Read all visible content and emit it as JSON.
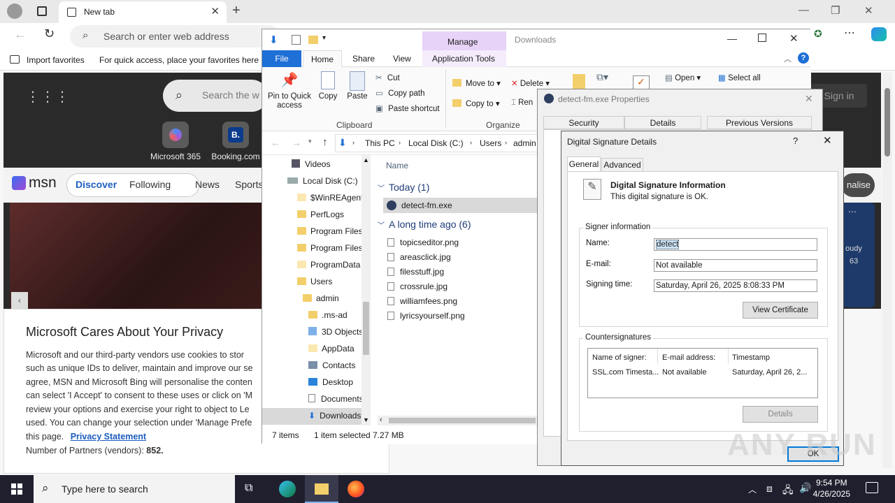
{
  "browser": {
    "tab_title": "New tab",
    "address_placeholder": "Search or enter web address",
    "favbar": {
      "import": "Import favorites",
      "hint": "For quick access, place your favorites here on"
    },
    "msn": {
      "search_placeholder": "Search the w",
      "shortcuts": [
        "Microsoft 365",
        "Booking.com"
      ],
      "sign_in": "Sign in",
      "brand": "msn",
      "nav": [
        "Discover",
        "Following",
        "News",
        "Sports"
      ],
      "personalise": "nalise",
      "weather_fragment": "oudy",
      "temp_fragment": "63"
    },
    "privacy": {
      "title": "Microsoft Cares About Your Privacy",
      "lines": [
        "Microsoft and our third-party vendors use cookies to stor",
        "such as unique IDs to deliver, maintain and improve our se",
        "agree, MSN and Microsoft Bing will personalise the conten",
        "can select 'I Accept' to consent to these uses or click on 'M",
        "review your options and exercise your right to object to Le",
        "used. You can change your selection under 'Manage Prefe"
      ],
      "page_prefix": "this page.",
      "link": "Privacy Statement",
      "partners_label": "Number of Partners (vendors):",
      "partners_count": "852."
    }
  },
  "explorer": {
    "title": "Downloads",
    "manage": "Manage",
    "tabs": [
      "File",
      "Home",
      "Share",
      "View",
      "Application Tools"
    ],
    "ribbon": {
      "pin": "Pin to Quick access",
      "copy": "Copy",
      "paste": "Paste",
      "cut": "Cut",
      "copy_path": "Copy path",
      "paste_shortcut": "Paste shortcut",
      "move_to": "Move to",
      "copy_to": "Copy to",
      "delete": "Delete",
      "rename": "Ren",
      "open": "Open",
      "select_all": "Select all",
      "group_clipboard": "Clipboard",
      "group_organize": "Organize"
    },
    "breadcrumb": [
      "This PC",
      "Local Disk (C:)",
      "Users",
      "admin"
    ],
    "tree": [
      "Videos",
      "Local Disk (C:)",
      "$WinREAgent",
      "PerfLogs",
      "Program Files",
      "Program Files",
      "ProgramData",
      "Users",
      "admin",
      ".ms-ad",
      "3D Objects",
      "AppData",
      "Contacts",
      "Desktop",
      "Documents",
      "Downloads"
    ],
    "column_name": "Name",
    "group_today": "Today (1)",
    "group_old": "A long time ago (6)",
    "selected_file": "detect-fm.exe",
    "files": [
      "topicseditor.png",
      "areasclick.jpg",
      "filesstuff.jpg",
      "crossrule.jpg",
      "williamfees.png",
      "lyricsyourself.png"
    ],
    "status": {
      "items": "7 items",
      "selected": "1 item selected",
      "size": "7.27 MB"
    }
  },
  "properties": {
    "title": "detect-fm.exe Properties",
    "tabs": [
      "Security",
      "Details",
      "Previous Versions"
    ]
  },
  "signature": {
    "title": "Digital Signature Details",
    "help": "?",
    "tabs": [
      "General",
      "Advanced"
    ],
    "info_title": "Digital Signature Information",
    "info_text": "This digital signature is OK.",
    "signer_group": "Signer information",
    "name_label": "Name:",
    "name_value": "detect",
    "email_label": "E-mail:",
    "email_value": "Not available",
    "time_label": "Signing time:",
    "time_value": "Saturday, April 26, 2025 8:08:33 PM",
    "view_cert": "View Certificate",
    "counter_group": "Countersignatures",
    "counter_headers": [
      "Name of signer:",
      "E-mail address:",
      "Timestamp"
    ],
    "counter_row": [
      "SSL.com Timesta...",
      "Not available",
      "Saturday, April 26, 2..."
    ],
    "details_btn": "Details",
    "ok": "OK"
  },
  "taskbar": {
    "search_placeholder": "Type here to search",
    "time": "9:54 PM",
    "date": "4/26/2025"
  },
  "watermark": "ANY RUN"
}
